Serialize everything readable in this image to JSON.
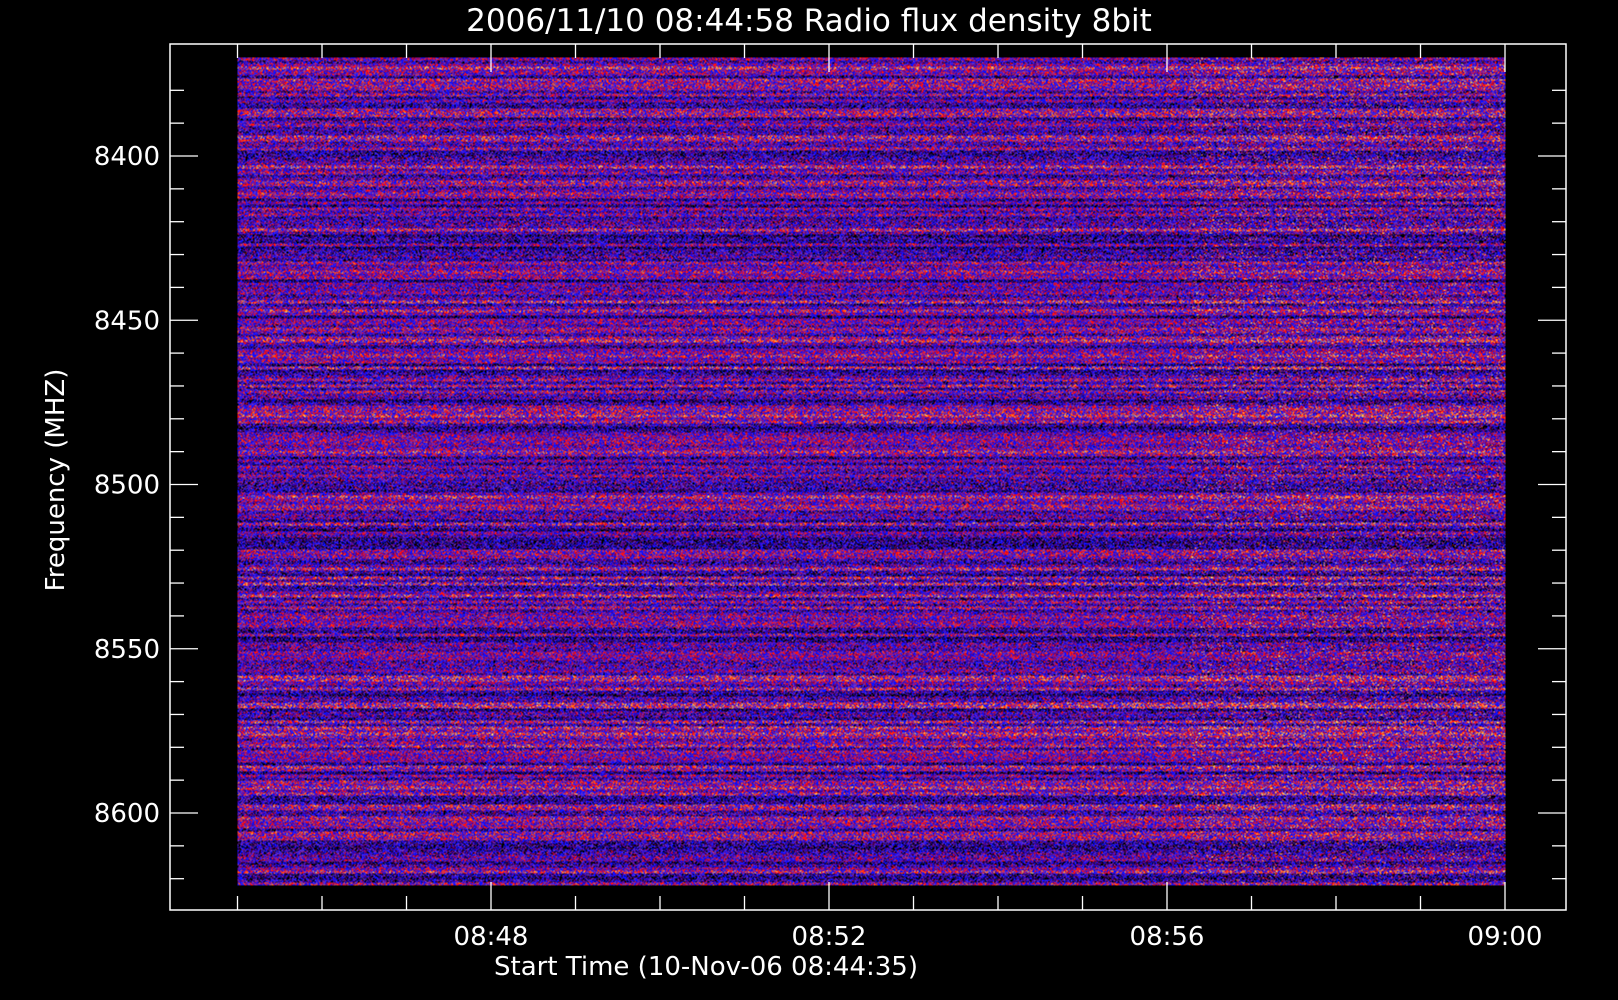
{
  "chart_data": {
    "type": "heatmap",
    "title": "2006/11/10 08:44:58 Radio flux density 8bit",
    "xlabel": "Start Time (10-Nov-06 08:44:35)",
    "ylabel": "Frequency (MHZ)",
    "x_ticks": [
      {
        "label": "08:48",
        "minutes": 48
      },
      {
        "label": "08:52",
        "minutes": 52
      },
      {
        "label": "08:56",
        "minutes": 56
      },
      {
        "label": "09:00",
        "minutes": 60
      }
    ],
    "y_ticks": [
      {
        "label": "8400",
        "value": 8400
      },
      {
        "label": "8450",
        "value": 8450
      },
      {
        "label": "8500",
        "value": 8500
      },
      {
        "label": "8550",
        "value": 8550
      },
      {
        "label": "8600",
        "value": 8600
      }
    ],
    "xlim": [
      "08:44:35",
      "09:00:00"
    ],
    "ylim": [
      8366,
      8626
    ],
    "data_xrange": [
      "08:45:00",
      "09:00:00"
    ],
    "data_yrange": [
      8370,
      8622
    ],
    "y_inverted": true,
    "colormap": [
      "#000000",
      "#5a0070",
      "#1010ff",
      "#7030c0",
      "#ff1010",
      "#ff7020",
      "#ffd060"
    ],
    "grid": false,
    "legend": "none",
    "background": "#000000",
    "foreground": "#ffffff"
  }
}
